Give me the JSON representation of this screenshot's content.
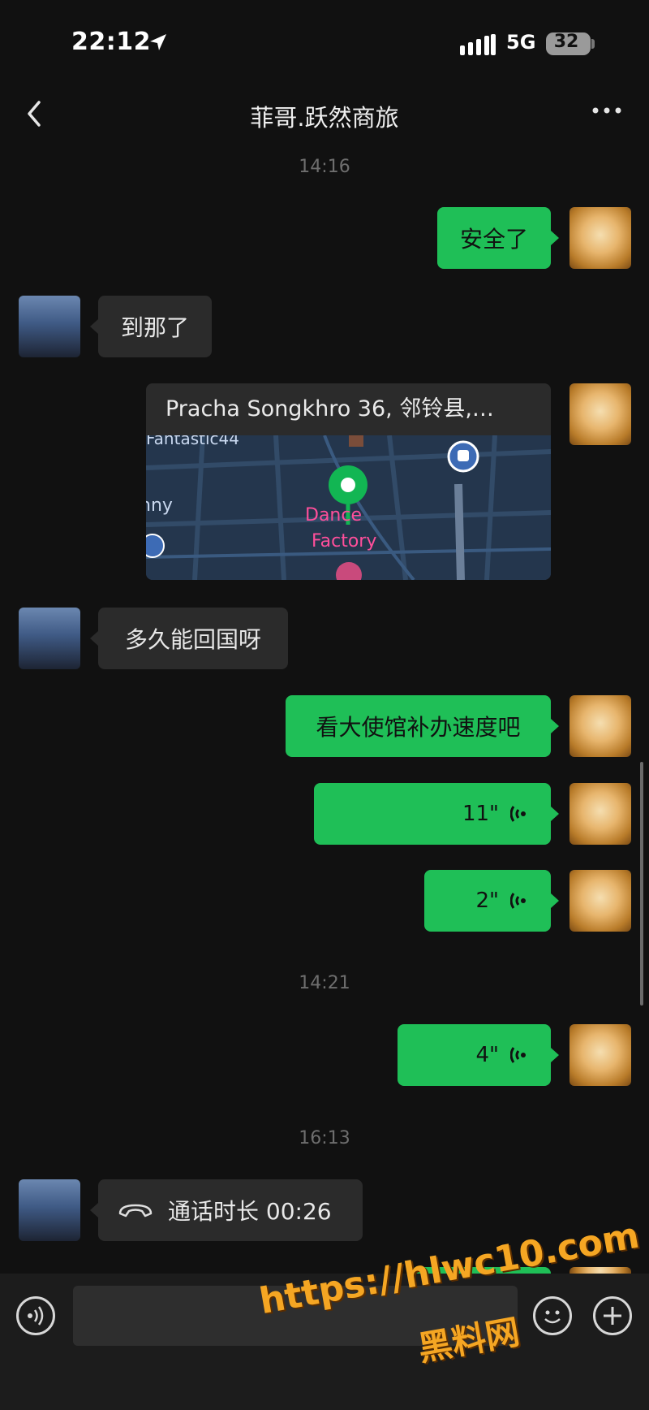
{
  "status_bar": {
    "time": "22:12",
    "network": "5G",
    "battery": "32"
  },
  "nav": {
    "title": "菲哥.跃然商旅"
  },
  "timestamps": [
    "14:16",
    "14:21",
    "16:13"
  ],
  "messages": {
    "m1": "安全了",
    "m2": "到那了",
    "location": {
      "address": "Pracha Songkhro 36, 邻铃县,…",
      "map_labels": [
        "Fantastic44",
        "nny",
        "Dance",
        "Factory"
      ]
    },
    "m3": "多久能回国呀",
    "m4": "看大使馆补办速度吧",
    "voice1": "11\"",
    "voice2": "2\"",
    "voice3": "4\"",
    "call": "通话时长 00:26"
  },
  "icons": {
    "back": "chevron-left-icon",
    "more": "more-dots-icon",
    "voice_input": "voice-input-icon",
    "emoji": "emoji-icon",
    "add": "plus-icon",
    "phone": "phone-hangup-icon"
  },
  "watermark": {
    "url": "https://hlwc10.com",
    "label": "黑料网"
  },
  "colors": {
    "outgoing": "#1fbf57",
    "incoming": "#2b2b2b",
    "background": "#111111"
  }
}
